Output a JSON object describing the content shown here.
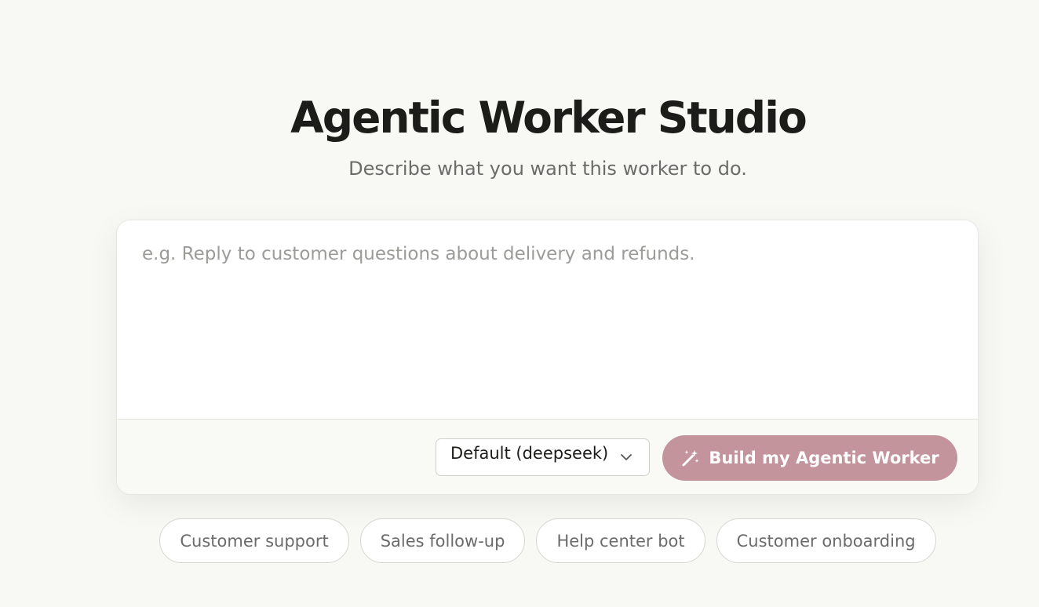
{
  "header": {
    "title": "Agentic Worker Studio",
    "subtitle": "Describe what you want this worker to do."
  },
  "composer": {
    "placeholder": "e.g. Reply to customer questions about delivery and refunds.",
    "value": "",
    "model_select": {
      "selected": "Default (deepseek)",
      "icon": "chevron-down-icon"
    },
    "build_button": {
      "label": "Build my Agentic Worker",
      "icon": "magic-wand-icon",
      "color": "#c4949d"
    }
  },
  "suggestions": [
    {
      "label": "Customer support"
    },
    {
      "label": "Sales follow-up"
    },
    {
      "label": "Help center bot"
    },
    {
      "label": "Customer onboarding"
    }
  ]
}
